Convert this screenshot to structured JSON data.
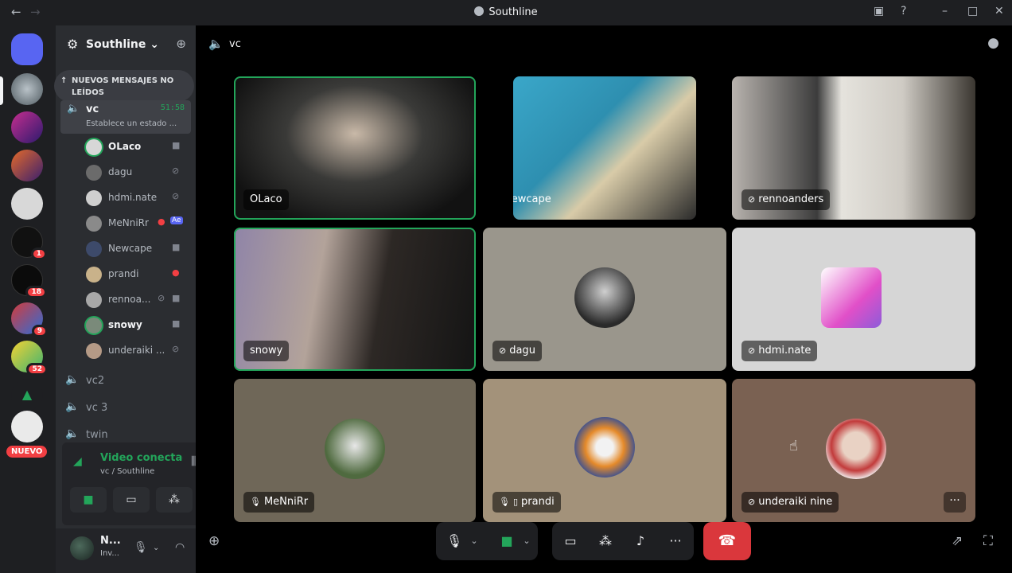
{
  "window": {
    "title": "Southline"
  },
  "server": {
    "name": "Southline",
    "unread_banner": "NUEVOS MENSAJES NO LEÍDOS",
    "new_label": "NUEVO",
    "badges": [
      "1",
      "18",
      "9",
      "52"
    ]
  },
  "channels": {
    "active": {
      "name": "vc",
      "timer": "51:58",
      "status": "Establece un estado ..."
    },
    "members": [
      {
        "name": "OLaco",
        "live": true
      },
      {
        "name": "dagu"
      },
      {
        "name": "hdmi.nate"
      },
      {
        "name": "MeNniRr",
        "extra": "Ae"
      },
      {
        "name": "Newcape"
      },
      {
        "name": "prandi"
      },
      {
        "name": "rennoa..."
      },
      {
        "name": "snowy",
        "live": true
      },
      {
        "name": "underaiki ..."
      }
    ],
    "others": [
      "vc2",
      "vc 3",
      "twin"
    ]
  },
  "voice_panel": {
    "title": "Video conectac",
    "subtitle": "vc / Southline"
  },
  "user_panel": {
    "name": "N...",
    "status": "Inv..."
  },
  "stage": {
    "channel": "vc",
    "tiles": [
      {
        "name": "OLaco"
      },
      {
        "name": "Newcape"
      },
      {
        "name": "rennoanders"
      },
      {
        "name": "snowy"
      },
      {
        "name": "dagu"
      },
      {
        "name": "hdmi.nate"
      },
      {
        "name": "MeNniRr"
      },
      {
        "name": "prandi"
      },
      {
        "name": "underaiki nine"
      }
    ]
  },
  "colors": {
    "speaking": "#23a55a",
    "hangup": "#da373c",
    "badge": "#f23f43"
  },
  "icons": [
    "discord-icon",
    "gear-icon",
    "invite-icon",
    "speaker-icon",
    "camera-icon",
    "mic-muted-icon",
    "mic-icon",
    "headphones-icon",
    "screenshare-icon",
    "activity-icon",
    "soundboard-icon",
    "hangup-icon",
    "chat-icon",
    "popout-icon",
    "fullscreen-icon"
  ]
}
